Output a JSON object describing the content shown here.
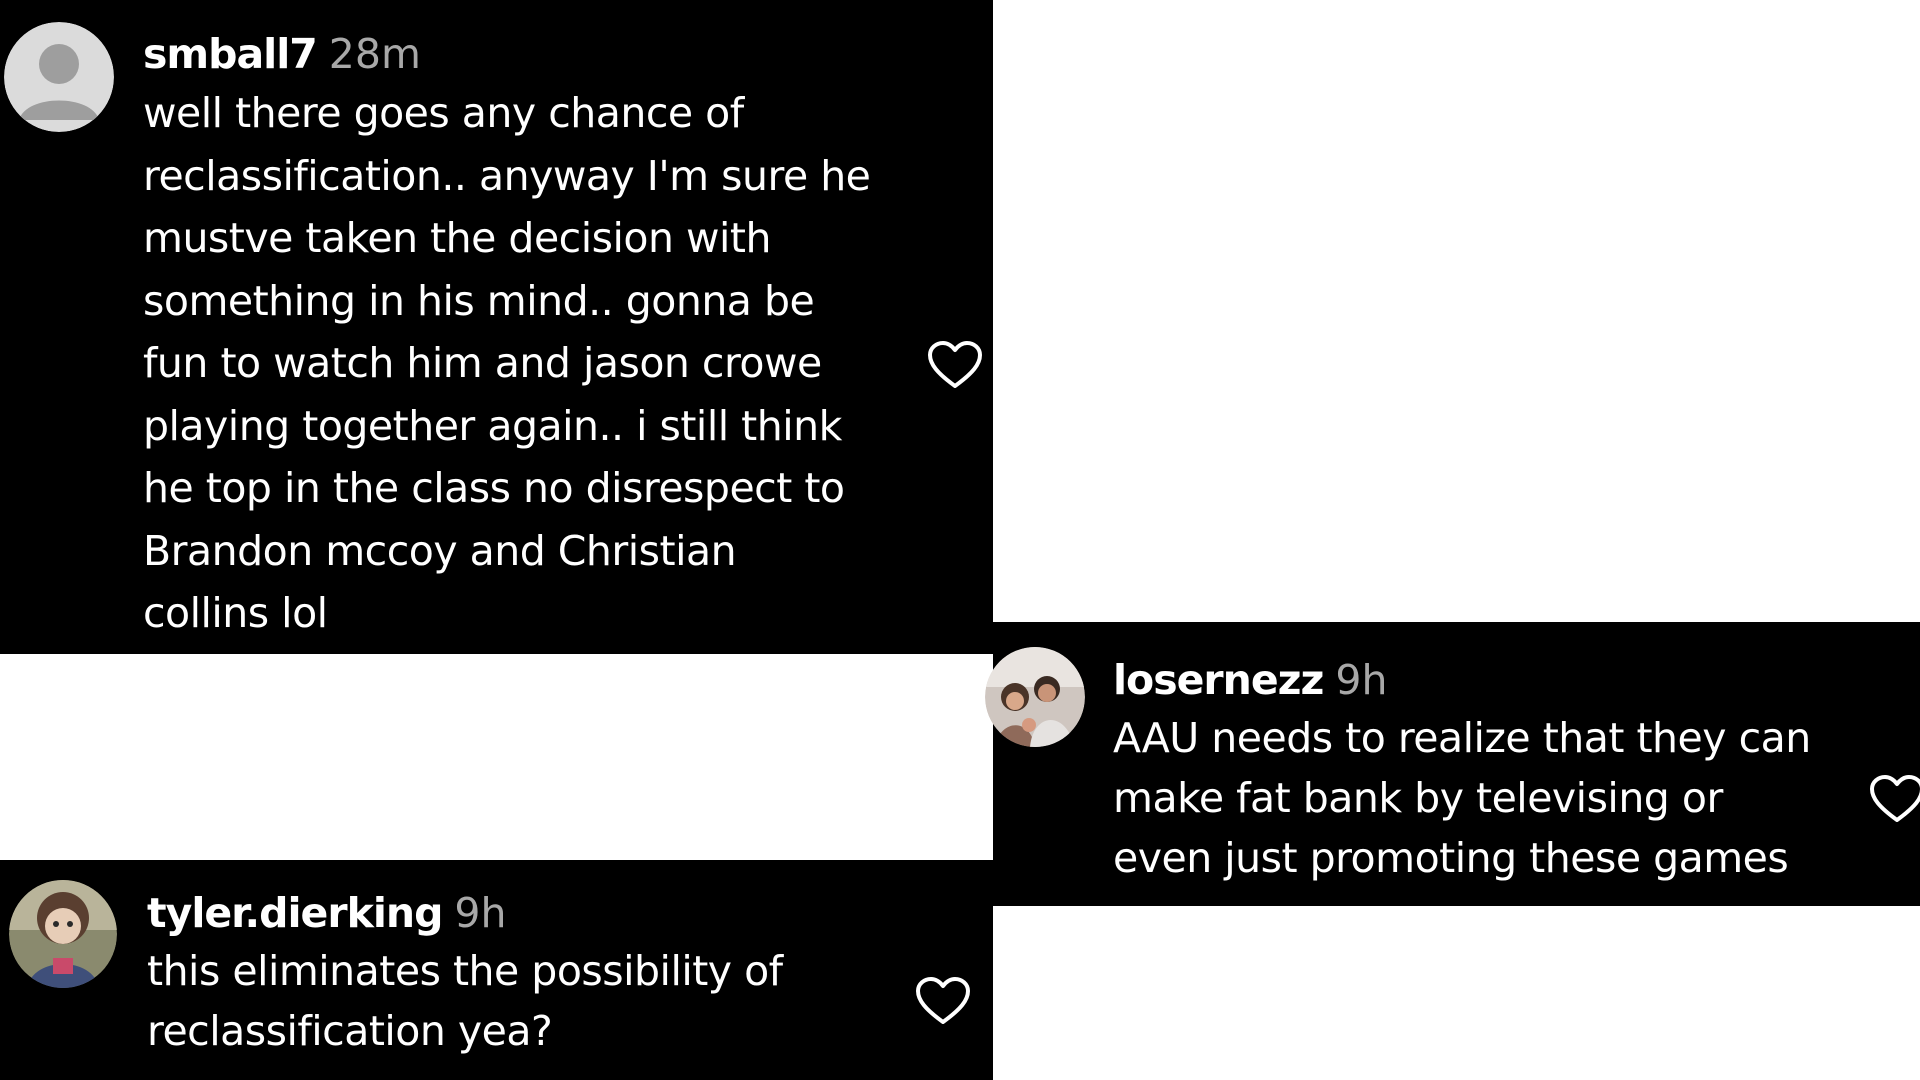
{
  "comments": [
    {
      "username": "smball7",
      "time": "28m",
      "text": "well there goes any chance of\nreclassification.. anyway I'm sure he\nmustve taken the decision with\nsomething in his mind.. gonna be\nfun to watch him and jason crowe\nplaying together again.. i still think\nhe top in the class no disrespect to\nBrandon mccoy and Christian\ncollins lol",
      "avatar_icon": "default-avatar-icon",
      "like_icon": "heart-icon"
    },
    {
      "username": "losernezz",
      "time": "9h",
      "text": "AAU needs to realize that they can\nmake fat bank by televising or\neven just promoting these games",
      "avatar_icon": "photo-avatar-icon",
      "like_icon": "heart-icon"
    },
    {
      "username": "tyler.dierking",
      "time": "9h",
      "text": "this eliminates the possibility of\nreclassification yea?",
      "avatar_icon": "photo-avatar-icon",
      "like_icon": "heart-icon"
    }
  ],
  "colors": {
    "card_background": "#000000",
    "page_background": "#ffffff",
    "text": "#ffffff",
    "timestamp": "#a8a8a8",
    "default_avatar_bg": "#dbdbdb",
    "default_avatar_figure": "#9e9e9e"
  }
}
